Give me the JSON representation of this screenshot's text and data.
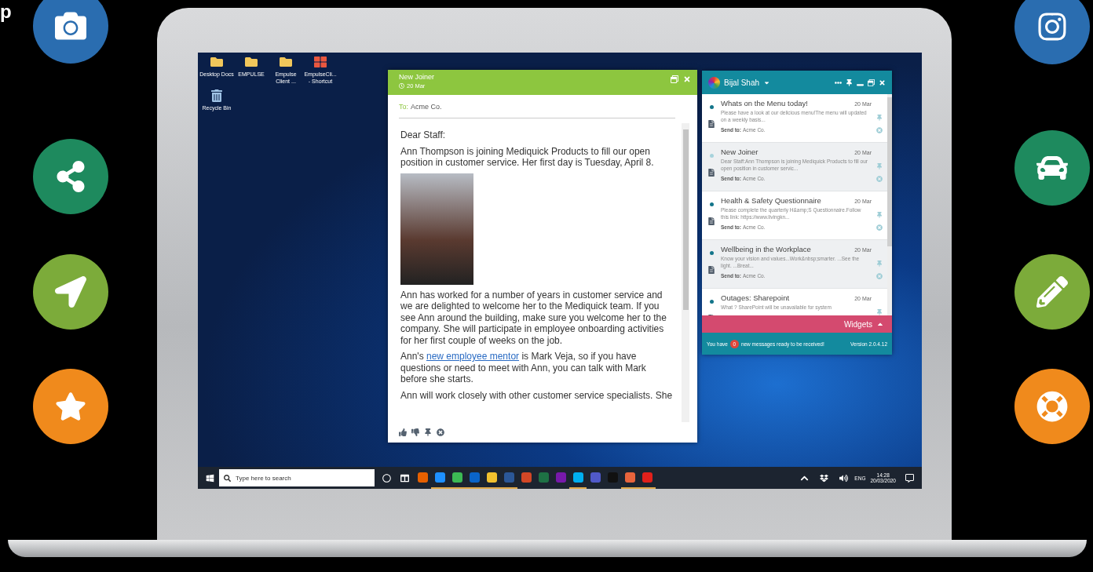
{
  "edge_text": "p",
  "side_icons": {
    "left": [
      {
        "kind": "camera",
        "color": "#2a6db0"
      },
      {
        "kind": "share",
        "color": "#1e8a5e"
      },
      {
        "kind": "arrow",
        "color": "#7cab3a"
      },
      {
        "kind": "star",
        "color": "#f08a1c"
      }
    ],
    "right": [
      {
        "kind": "instagram",
        "color": "#2a6db0"
      },
      {
        "kind": "car",
        "color": "#1e8a5e"
      },
      {
        "kind": "pencil",
        "color": "#7cab3a"
      },
      {
        "kind": "lifebuoy",
        "color": "#f08a1c"
      }
    ]
  },
  "desktop": {
    "icons": [
      {
        "kind": "folder",
        "label": "Desktop Docs"
      },
      {
        "kind": "folder",
        "label": "EMPULSE"
      },
      {
        "kind": "folder",
        "label": "Empulse Client ..."
      },
      {
        "kind": "shortcut",
        "label": "EmpulseCli... - Shortcut"
      },
      {
        "kind": "bin",
        "label": "Recycle Bin"
      }
    ]
  },
  "email_window": {
    "title": "New Joiner",
    "date": "20 Mar",
    "to_label": "To:",
    "to": "Acme Co.",
    "greeting": "Dear Staff:",
    "paragraphs": [
      {
        "kind": "text",
        "text": "Ann Thompson is joining Mediquick Products to fill our open position in customer service. Her first day is Tuesday, April 8."
      },
      {
        "kind": "photo"
      },
      {
        "kind": "text",
        "text": "Ann has worked for a number of years in customer service and we are delighted to welcome her to the Mediquick team. If you see Ann around the building, make sure you welcome her to the company. She will participate in employee onboarding activities for her first couple of weeks on the job."
      },
      {
        "kind": "link",
        "before": "Ann's ",
        "link": "new employee mentor",
        "after": " is Mark Veja, so if you have questions or need to meet with Ann, you can talk with Mark before she starts."
      },
      {
        "kind": "text",
        "text": "Ann will work closely with other customer service specialists. She"
      }
    ]
  },
  "feed": {
    "user": "Bijal Shah",
    "items": [
      {
        "title": "Whats on the Menu today!",
        "date": "20 Mar",
        "preview": "Please have a look at our delicious menu!The menu will updated on a weekly basis...",
        "send_to_label": "Send to:",
        "send_to": "Acme Co.",
        "unread": true
      },
      {
        "title": "New Joiner",
        "date": "20 Mar",
        "preview": "Dear Staff:Ann Thompson is joining Mediquick Products to fill our open position in customer servic...",
        "send_to_label": "Send to:",
        "send_to": "Acme Co.",
        "unread": false
      },
      {
        "title": "Health & Safety Questionnaire",
        "date": "20 Mar",
        "preview": "Please complete the quarterly H&amp;S Questionnaire.Follow this link: https://www.livingkn...",
        "send_to_label": "Send to:",
        "send_to": "Acme Co.",
        "unread": true
      },
      {
        "title": "Wellbeing in the Workplace",
        "date": "20 Mar",
        "preview": "Know your vision and values...Work&nbsp;smarter. ...See the light. ...Breat...",
        "send_to_label": "Send to:",
        "send_to": "Acme Co.",
        "unread": true
      },
      {
        "title": "Outages: Sharepoint",
        "date": "20 Mar",
        "preview": "What ? SharePoint will be unavailable for system",
        "unread": true
      }
    ],
    "widgets": "Widgets",
    "status_before": "You have",
    "count": "0",
    "status_after": "new messages ready to be received!",
    "version": "Version 2.0.4.12"
  },
  "taskbar": {
    "search_placeholder": "Type here to search",
    "apps": [
      {
        "color": "#e66000",
        "open": false
      },
      {
        "color": "#1e90ff",
        "open": true
      },
      {
        "color": "#3cba54",
        "open": true
      },
      {
        "color": "#0a64c8",
        "open": true
      },
      {
        "color": "#f2c12e",
        "open": true
      },
      {
        "color": "#2b5797",
        "open": true
      },
      {
        "color": "#d24726",
        "open": false
      },
      {
        "color": "#1e7145",
        "open": false
      },
      {
        "color": "#7719aa",
        "open": false
      },
      {
        "color": "#00aff0",
        "open": true
      },
      {
        "color": "#5059c9",
        "open": false
      },
      {
        "color": "#111111",
        "open": false
      },
      {
        "color": "#e8643c",
        "open": true
      },
      {
        "color": "#e0201b",
        "open": true
      }
    ],
    "language": "ENG",
    "time": "14:28",
    "date": "20/03/2020"
  }
}
